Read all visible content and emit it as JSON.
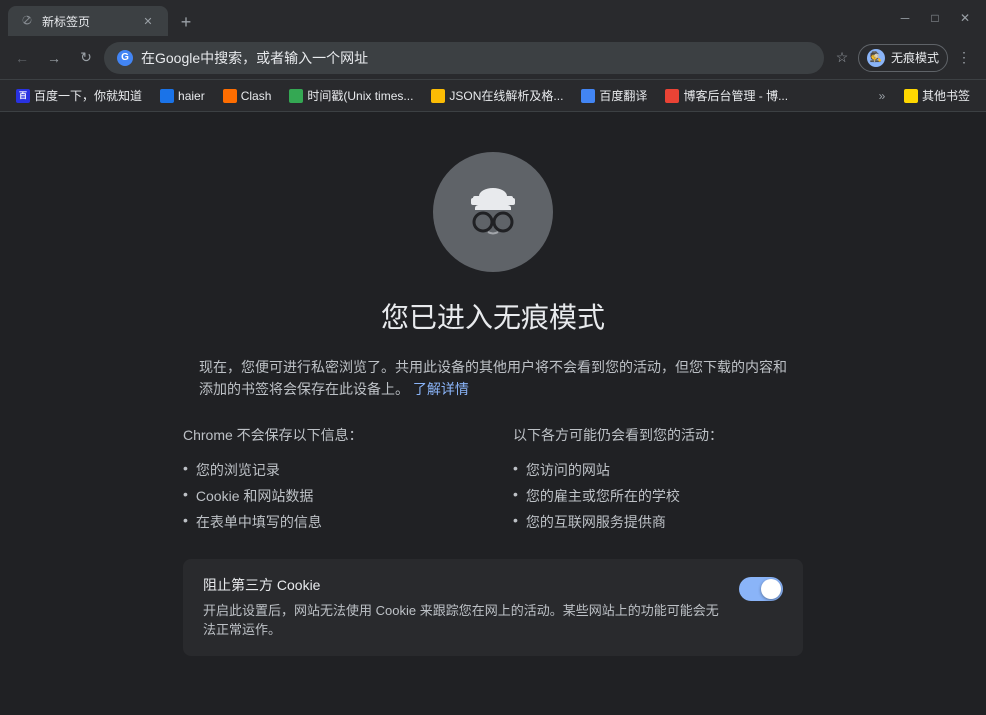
{
  "titlebar": {
    "tab_title": "新标签页",
    "new_tab_icon": "+",
    "minimize_label": "－",
    "maximize_label": "□",
    "close_label": "✕"
  },
  "toolbar": {
    "back_icon": "←",
    "forward_icon": "→",
    "refresh_icon": "↻",
    "address_text": "在Google中搜索，或者输入一个网址",
    "google_label": "G",
    "star_icon": "☆",
    "profile_label": "无痕模式",
    "menu_icon": "⋮"
  },
  "bookmarks": [
    {
      "id": "baidu",
      "label": "百度一下，你就知道",
      "color_class": "fav-baidu"
    },
    {
      "id": "haier",
      "label": "haier",
      "color_class": "fav-haier"
    },
    {
      "id": "clash",
      "label": "Clash",
      "color_class": "fav-clash"
    },
    {
      "id": "time",
      "label": "时间戳(Unix times...",
      "color_class": "fav-time"
    },
    {
      "id": "json",
      "label": "JSON在线解析及格...",
      "color_class": "fav-json"
    },
    {
      "id": "translate",
      "label": "百度翻译",
      "color_class": "fav-translate"
    },
    {
      "id": "blog",
      "label": "博客后台管理 - 博...",
      "color_class": "fav-blog"
    },
    {
      "id": "more",
      "label": "»",
      "color_class": ""
    },
    {
      "id": "other",
      "label": "其他书签",
      "color_class": "fav-other"
    }
  ],
  "main": {
    "incognito_title": "您已进入无痕模式",
    "description_line1": "现在，您便可进行私密浏览了。共用此设备的其他用户将不会看到您的活动，但您下载的内容和",
    "description_line2": "添加的书签将会保存在此设备上。",
    "learn_more": "了解详情",
    "chrome_wont_save_title": "Chrome 不会保存以下信息：",
    "chrome_wont_save_items": [
      "您的浏览记录",
      "Cookie 和网站数据",
      "在表单中填写的信息"
    ],
    "still_visible_title": "以下各方可能仍会看到您的活动：",
    "still_visible_items": [
      "您访问的网站",
      "您的雇主或您所在的学校",
      "您的互联网服务提供商"
    ],
    "cookie_title": "阻止第三方 Cookie",
    "cookie_desc": "开启此设置后，网站无法使用 Cookie 来跟踪您在网上的活动。某些网站上的功能可能会无法正常运作。"
  }
}
